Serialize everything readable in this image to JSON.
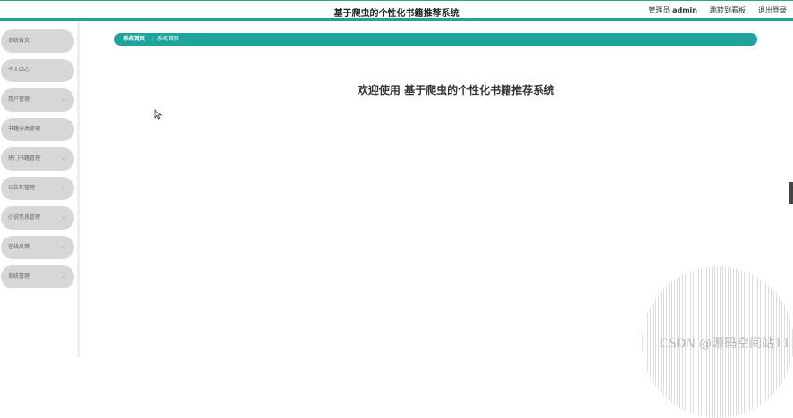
{
  "header": {
    "title": "基于爬虫的个性化书籍推荐系统",
    "admin_label": "管理员",
    "admin_name": "admin",
    "jump_label": "跳转到看板",
    "logout_label": "退出登录"
  },
  "sidebar": {
    "items": [
      {
        "label": "系统首页"
      },
      {
        "label": "个人中心"
      },
      {
        "label": "用户管理"
      },
      {
        "label": "书籍分类管理"
      },
      {
        "label": "热门书籍管理"
      },
      {
        "label": "公告栏管理"
      },
      {
        "label": "小说信息管理"
      },
      {
        "label": "在线反馈"
      },
      {
        "label": "系统管理"
      }
    ]
  },
  "breadcrumb": {
    "root": "系统首页",
    "separator": "⋮",
    "current": "系统首页"
  },
  "main": {
    "welcome": "欢迎使用 基于爬虫的个性化书籍推荐系统"
  },
  "watermark": "CSDN @源码空间站11",
  "colors": {
    "accent": "#1ea39d",
    "sidebar_item_bg": "#d7d7d7"
  }
}
